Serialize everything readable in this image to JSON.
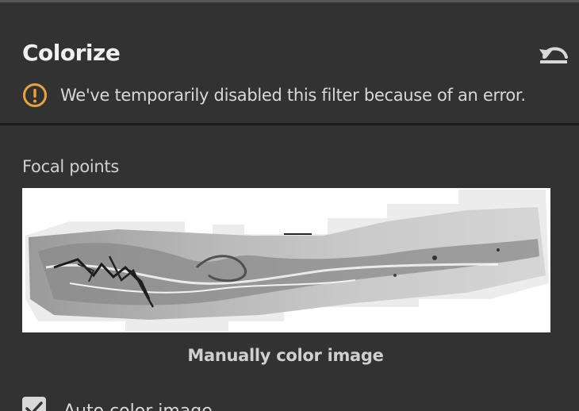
{
  "panel": {
    "title": "Colorize",
    "reset_icon": "undo-arrow-icon",
    "warning_icon": "exclamation-circle-icon",
    "warning_text": "We've temporarily disabled this filter because of an error.",
    "accent_color": "#e8a43a"
  },
  "focal_points": {
    "label": "Focal points"
  },
  "actions": {
    "manual_color_label": "Manually color image",
    "auto_color_label": "Auto color image",
    "auto_color_checked": true
  }
}
